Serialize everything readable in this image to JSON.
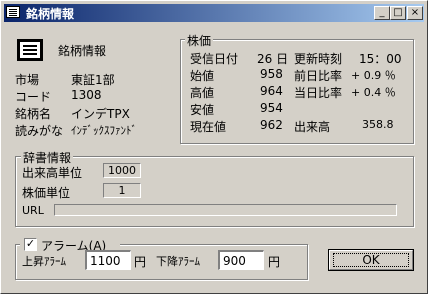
{
  "window": {
    "title": "銘柄情報",
    "buttons": {
      "minimize": "_",
      "maximize": "□",
      "close": "×"
    }
  },
  "header": {
    "title": "銘柄情報"
  },
  "info": [
    {
      "label": "市場",
      "value": "東証1部"
    },
    {
      "label": "コード",
      "value": "1308"
    },
    {
      "label": "銘柄名",
      "value": "インデTPX"
    },
    {
      "label": "読みがな",
      "value": "ｲﾝﾃﾞｯｸｽﾌｧﾝﾄﾞ"
    }
  ],
  "stock": {
    "legend": "株価",
    "receive_date_label": "受信日付",
    "receive_date_value": "26 日",
    "update_time_label": "更新時刻",
    "update_time_value": "15：00",
    "open_label": "始値",
    "open_value": "958",
    "prev_ratio_label": "前日比率",
    "prev_ratio_value": "+ 0.9 ％",
    "high_label": "高値",
    "high_value": "964",
    "today_ratio_label": "当日比率",
    "today_ratio_value": "+ 0.4 ％",
    "low_label": "安値",
    "low_value": "954",
    "current_label": "現在値",
    "current_value": "962",
    "volume_label": "出来高",
    "volume_value": "358.8"
  },
  "dictionary": {
    "legend": "辞書情報",
    "volume_unit_label": "出来高単位",
    "volume_unit_value": "1000",
    "price_unit_label": "株価単位",
    "price_unit_value": "1",
    "url_label": "URL",
    "url_value": ""
  },
  "alarm": {
    "legend": "アラーム(A)",
    "checked": "✓",
    "rise_label": "上昇ｱﾗｰﾑ",
    "rise_value": "1100",
    "fall_label": "下降ｱﾗｰﾑ",
    "fall_value": "900",
    "yen": "円"
  },
  "ok_label": "OK"
}
